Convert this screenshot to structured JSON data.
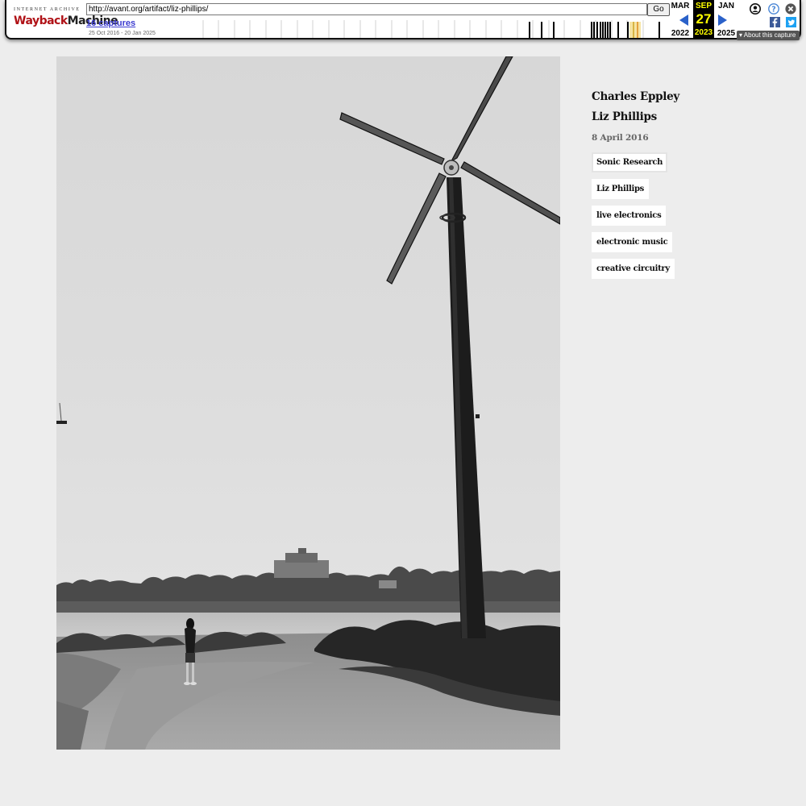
{
  "wayback": {
    "logo_top": "INTERNET ARCHIVE",
    "logo_red": "Wayback",
    "logo_black": "Machine",
    "url": "http://avant.org/artifact/liz-phillips/",
    "go_label": "Go",
    "captures": "16 captures",
    "range": "25 Oct 2016 - 20 Jan 2025",
    "prev": {
      "month": "MAR",
      "year": "2022"
    },
    "current": {
      "month": "SEP",
      "day": "27",
      "year": "2023"
    },
    "next": {
      "month": "JAN",
      "year": "2025"
    },
    "about": "About this capture",
    "icons": [
      "account-icon",
      "help-icon",
      "close-icon",
      "facebook-icon",
      "twitter-icon"
    ]
  },
  "artifact": {
    "authors": [
      "Charles Eppley",
      "Liz Phillips"
    ],
    "date": "8 April 2016",
    "tags": [
      "Sonic Research",
      "Liz Phillips",
      "live electronics",
      "electronic music",
      "creative circuitry"
    ]
  }
}
